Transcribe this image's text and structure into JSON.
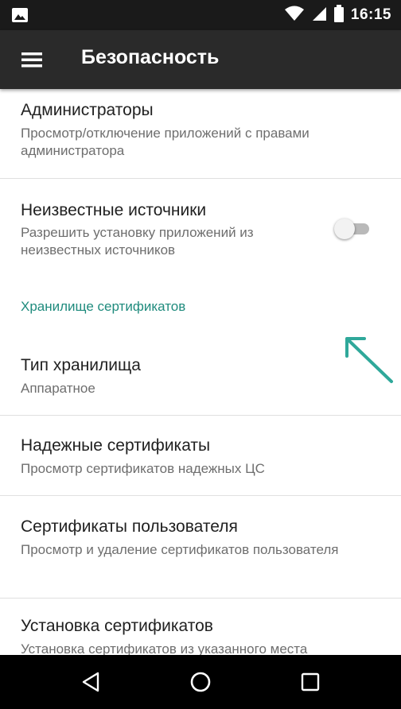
{
  "status_bar": {
    "time": "16:15",
    "icons": [
      "image-icon",
      "wifi-icon",
      "cellular-signal-icon",
      "battery-icon"
    ]
  },
  "toolbar": {
    "menu_icon": "hamburger-menu-icon",
    "title": "Безопасность"
  },
  "settings": {
    "administrators": {
      "title": "Администраторы",
      "summary": "Просмотр/отключение приложений с правами администратора"
    },
    "unknown_sources": {
      "title": "Неизвестные источники",
      "summary": "Разрешить установку приложений из неизвестных источников",
      "enabled": false
    },
    "credential_storage_header": "Хранилище сертификатов",
    "storage_type": {
      "title": "Тип хранилища",
      "summary": "Аппаратное"
    },
    "trusted_credentials": {
      "title": "Надежные сертификаты",
      "summary": "Просмотр сертификатов надежных ЦС"
    },
    "user_credentials": {
      "title": "Сертификаты пользователя",
      "summary": "Просмотр и удаление сертификатов пользователя"
    },
    "install_certificates": {
      "title": "Установка сертификатов",
      "summary": "Установка сертификатов из указанного места"
    }
  },
  "annotation": {
    "arrow_color": "#2fa89a"
  },
  "colors": {
    "status_bar": "#1a1a1a",
    "toolbar": "#2a2a2a",
    "accent": "#1f8b7d"
  },
  "nav_bar": {
    "buttons": [
      "back-icon",
      "home-icon",
      "recents-icon"
    ]
  }
}
